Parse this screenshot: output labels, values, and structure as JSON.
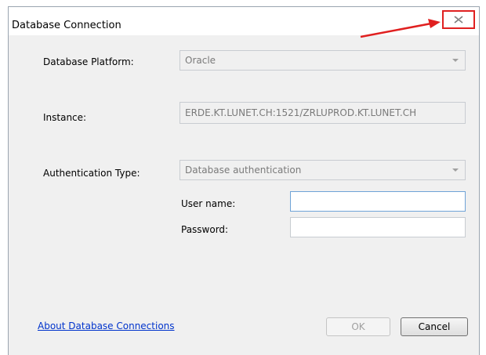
{
  "window": {
    "title": "Database Connection"
  },
  "form": {
    "platform_label": "Database Platform:",
    "platform_value": "Oracle",
    "instance_label": "Instance:",
    "instance_value": "ERDE.KT.LUNET.CH:1521/ZRLUPROD.KT.LUNET.CH",
    "auth_label": "Authentication Type:",
    "auth_value": "Database authentication",
    "username_label": "User name:",
    "username_value": "",
    "password_label": "Password:",
    "password_value": ""
  },
  "footer": {
    "about_link": "About Database Connections",
    "ok_label": "OK",
    "cancel_label": "Cancel"
  },
  "colors": {
    "annotation": "#e02020",
    "link": "#0033cc"
  },
  "icons": {
    "close": "close-icon",
    "dropdown": "chevron-down-icon",
    "annotation_arrow": "arrow-icon"
  }
}
